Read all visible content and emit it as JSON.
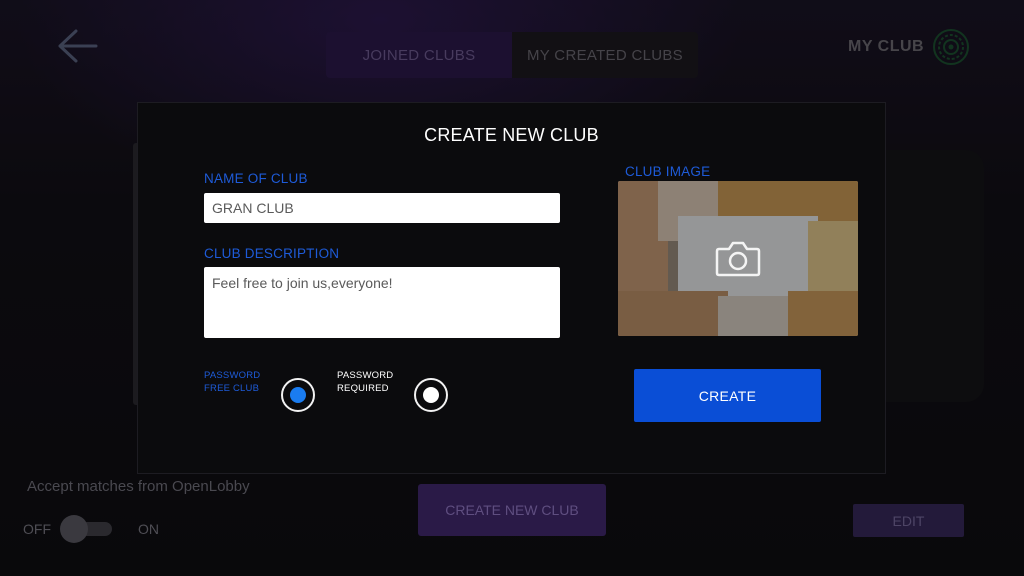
{
  "header": {
    "tabs": [
      {
        "label": "JOINED CLUBS",
        "active": true
      },
      {
        "label": "MY CREATED CLUBS",
        "active": false
      }
    ],
    "my_club_label": "MY CLUB"
  },
  "modal": {
    "title": "CREATE NEW CLUB",
    "name_label": "NAME OF CLUB",
    "name_value": "GRAN CLUB",
    "description_label": "CLUB DESCRIPTION",
    "description_value": "Feel free to join us,everyone!",
    "password_free_label_line1": "PASSWORD",
    "password_free_label_line2": "FREE CLUB",
    "password_required_label_line1": "PASSWORD",
    "password_required_label_line2": "REQUIRED",
    "selected_option": "password_free",
    "image_label": "CLUB IMAGE",
    "create_button": "CREATE"
  },
  "footer": {
    "accept_label": "Accept matches from OpenLobby",
    "toggle_off": "OFF",
    "toggle_on": "ON",
    "toggle_state": "off",
    "create_new_club_button": "CREATE NEW CLUB",
    "edit_button": "EDIT"
  },
  "colors": {
    "accent_blue": "#1e5bd8",
    "button_blue": "#0a4ed6",
    "radio_selected": "#1a7cf0",
    "radio_unselected": "#ffffff",
    "tab_purple": "#2b1a4a"
  },
  "icons": {
    "back": "arrow-left-icon",
    "club": "dartboard-icon",
    "image": "camera-icon"
  }
}
